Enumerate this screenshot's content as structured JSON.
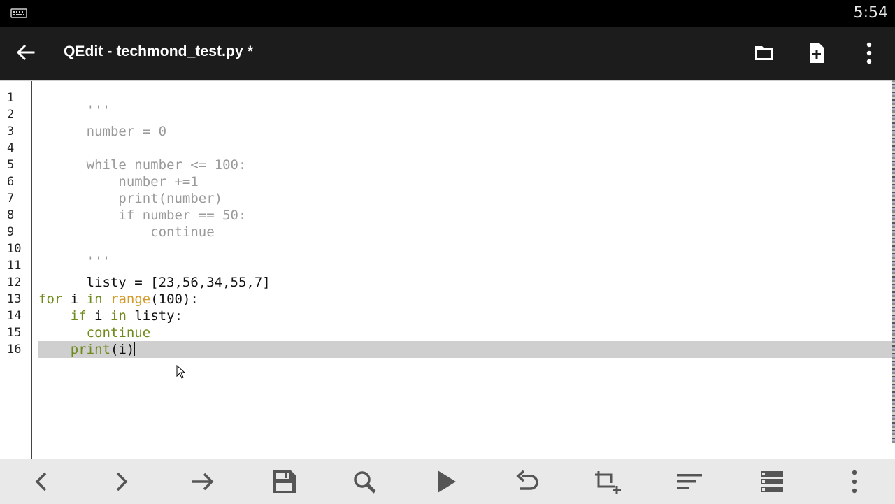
{
  "status_bar": {
    "time": "5:54",
    "keyboard_icon": "keyboard-icon"
  },
  "app_bar": {
    "title": "QEdit - techmond_test.py *",
    "icons": [
      "back-arrow-icon",
      "folder-icon",
      "new-file-icon",
      "overflow-menu-icon"
    ]
  },
  "editor": {
    "line_numbers": [
      "1",
      "2",
      "3",
      "4",
      "5",
      "6",
      "7",
      "8",
      "9",
      "10",
      "11",
      "12",
      "13",
      "14",
      "15",
      "16"
    ],
    "current_line": 16,
    "code_lines": [
      "'''",
      "number = 0",
      "",
      "while number <= 100:",
      "    number +=1",
      "    print(number)",
      "    if number == 50:",
      "        continue",
      "",
      "'''",
      "listy = [23,56,34,55,7]",
      "",
      "for i in range(100):",
      "    if i in listy:",
      "      continue",
      "    print(i)"
    ],
    "colors": {
      "comment": "#9a9a9a",
      "keyword": "#6e8a1a",
      "builtin": "#d39a2a",
      "current_line": "#cfcfcf"
    }
  },
  "bottom_toolbar": {
    "icons": [
      "chevron-left-icon",
      "chevron-right-icon",
      "arrow-right-icon",
      "save-icon",
      "search-icon",
      "play-icon",
      "undo-icon",
      "crop-add-icon",
      "sort-lines-icon",
      "list-view-icon",
      "overflow-menu-icon"
    ]
  }
}
